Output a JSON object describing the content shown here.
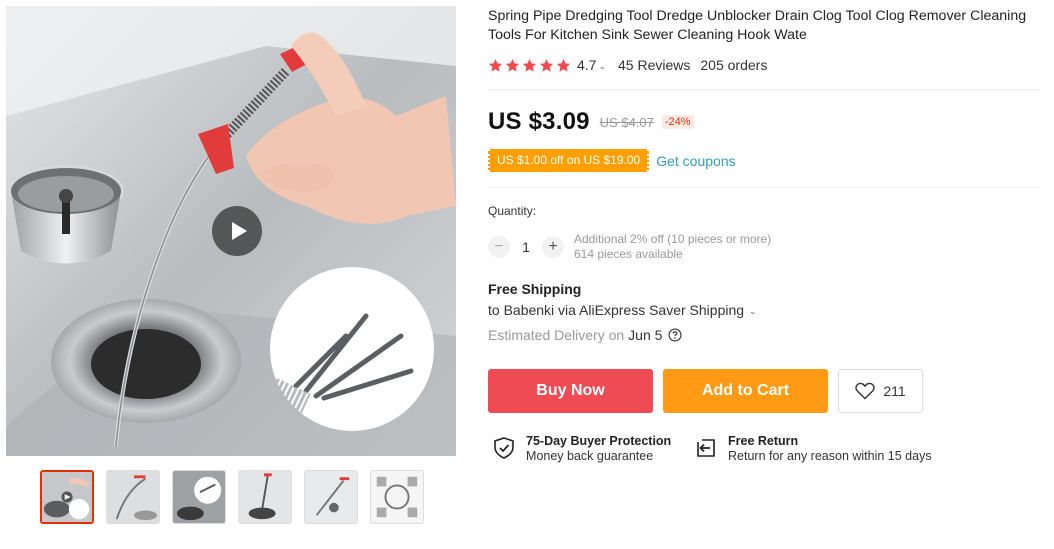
{
  "gallery": {
    "main_image_desc": "hand-drain-tool",
    "play_icon": "play-icon",
    "thumbnails": [
      {
        "id": "thumb-1",
        "active": true
      },
      {
        "id": "thumb-2",
        "active": false
      },
      {
        "id": "thumb-3",
        "active": false
      },
      {
        "id": "thumb-4",
        "active": false
      },
      {
        "id": "thumb-5",
        "active": false
      },
      {
        "id": "thumb-6",
        "active": false
      }
    ]
  },
  "product": {
    "title": "Spring Pipe Dredging Tool Dredge Unblocker Drain Clog Tool Clog Remover Cleaning Tools For Kitchen Sink Sewer Cleaning Hook Wate",
    "rating": "4.7",
    "stars": 5,
    "reviews": "45 Reviews",
    "orders": "205 orders"
  },
  "pricing": {
    "price": "US $3.09",
    "old_price": "US $4.07",
    "discount": "-24%",
    "coupon": "US $1.00 off on US $19.00",
    "get_coupons": "Get coupons"
  },
  "quantity": {
    "label": "Quantity:",
    "value": "1",
    "minus": "−",
    "plus": "+",
    "note": "Additional 2% off (10 pieces or more)",
    "available": "614 pieces available"
  },
  "shipping": {
    "title": "Free Shipping",
    "line": "to Babenki via AliExpress Saver Shipping",
    "estimated_label": "Estimated Delivery on",
    "date": "Jun 5"
  },
  "actions": {
    "buy_now": "Buy Now",
    "add_to_cart": "Add to Cart",
    "wishlist_count": "211"
  },
  "guarantees": {
    "protection_title": "75-Day Buyer Protection",
    "protection_sub": "Money back guarantee",
    "return_title": "Free Return",
    "return_sub": "Return for any reason within 15 days"
  },
  "colors": {
    "price_red": "#e62e04",
    "buy_now": "#ef4b54",
    "add_to_cart": "#ff9a14",
    "coupon": "#ff9f00",
    "link": "#2e9cc3",
    "star": "#f5494b"
  }
}
